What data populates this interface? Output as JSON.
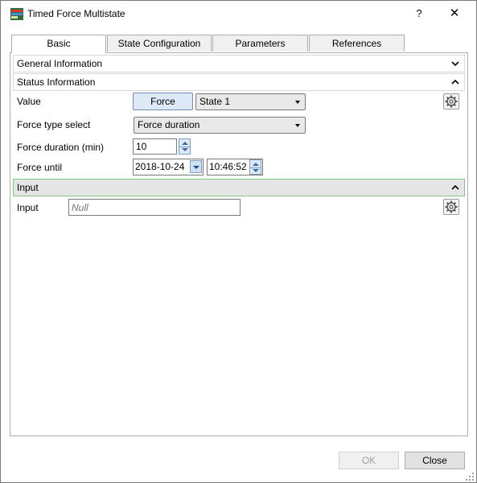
{
  "window": {
    "title": "Timed Force Multistate",
    "help_label": "?",
    "close_label": "✕"
  },
  "tabs": [
    {
      "label": "Basic",
      "active": true
    },
    {
      "label": "State Configuration",
      "active": false
    },
    {
      "label": "Parameters",
      "active": false
    },
    {
      "label": "References",
      "active": false
    }
  ],
  "sections": {
    "general": {
      "title": "General Information",
      "expanded": false
    },
    "status": {
      "title": "Status Information",
      "expanded": true
    },
    "input": {
      "title": "Input",
      "expanded": true
    }
  },
  "status": {
    "value_label": "Value",
    "force_button": "Force",
    "state_value": "State 1",
    "force_type_label": "Force type select",
    "force_type_value": "Force duration",
    "duration_label": "Force duration (min)",
    "duration_value": "10",
    "until_label": "Force until",
    "until_date": "2018-10-24",
    "until_time": "10:46:52"
  },
  "input": {
    "label": "Input",
    "placeholder": "Null"
  },
  "footer": {
    "ok_label": "OK",
    "close_label": "Close"
  },
  "colors": {
    "accent_border": "#7ec784",
    "button_fill": "#dde9f6"
  }
}
